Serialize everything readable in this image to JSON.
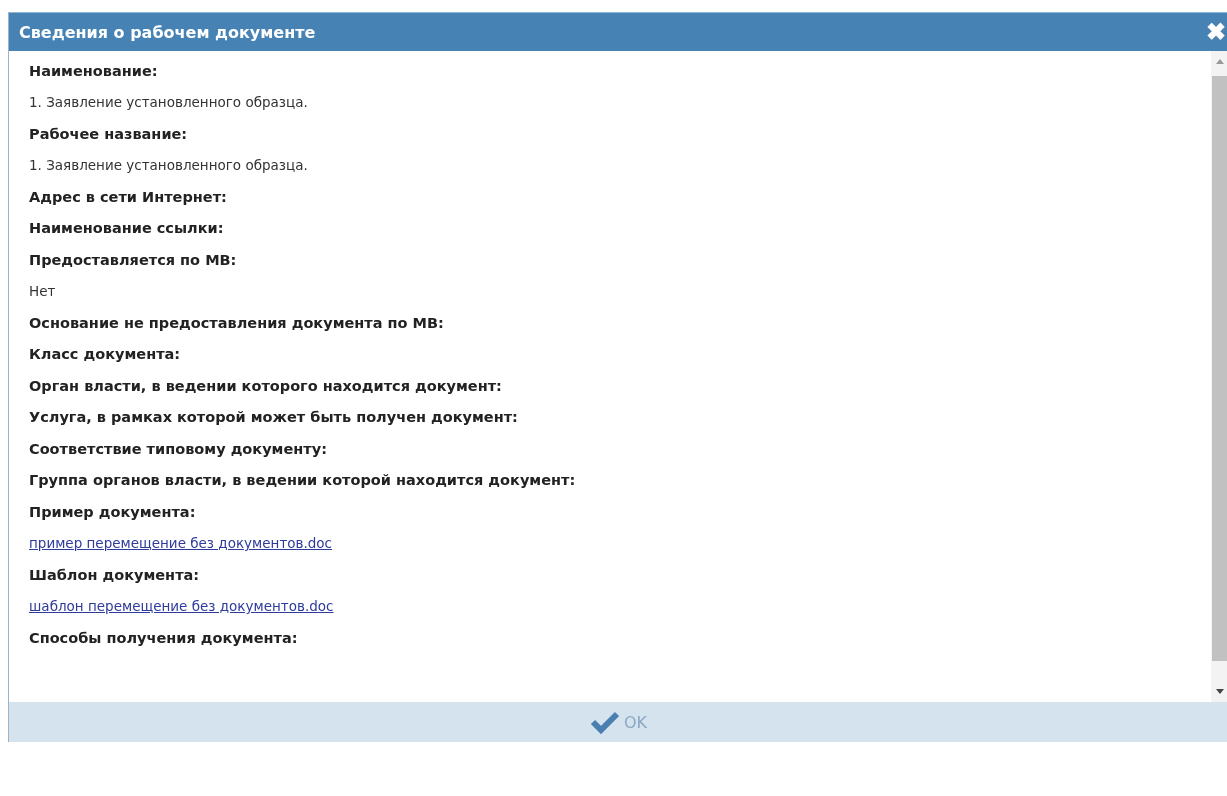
{
  "window": {
    "title": "Сведения о рабочем документе",
    "close": "✖"
  },
  "fields": [
    {
      "label": "Наименование:",
      "value": {
        "kind": "text",
        "text": "1. Заявление установленного образца."
      }
    },
    {
      "label": "Рабочее название:",
      "value": {
        "kind": "text",
        "text": "1. Заявление установленного образца."
      }
    },
    {
      "label": "Адрес в сети Интернет:"
    },
    {
      "label": "Наименование ссылки:"
    },
    {
      "label": "Предоставляется по МВ:",
      "value": {
        "kind": "text",
        "text": "Нет"
      }
    },
    {
      "label": "Основание не предоставления документа по МВ:"
    },
    {
      "label": "Класс документа:"
    },
    {
      "label": "Орган власти, в ведении которого находится документ:"
    },
    {
      "label": "Услуга, в рамках которой может быть получен документ:"
    },
    {
      "label": "Соответствие типовому документу:"
    },
    {
      "label": "Группа органов власти, в ведении которой находится документ:"
    },
    {
      "label": "Пример документа:",
      "value": {
        "kind": "link",
        "text": "пример перемещение без документов.doc"
      }
    },
    {
      "label": "Шаблон документа:",
      "value": {
        "kind": "link",
        "text": "шаблон перемещение без документов.doc"
      }
    },
    {
      "label": "Способы получения документа:"
    }
  ],
  "footer": {
    "ok_button": "OK"
  }
}
